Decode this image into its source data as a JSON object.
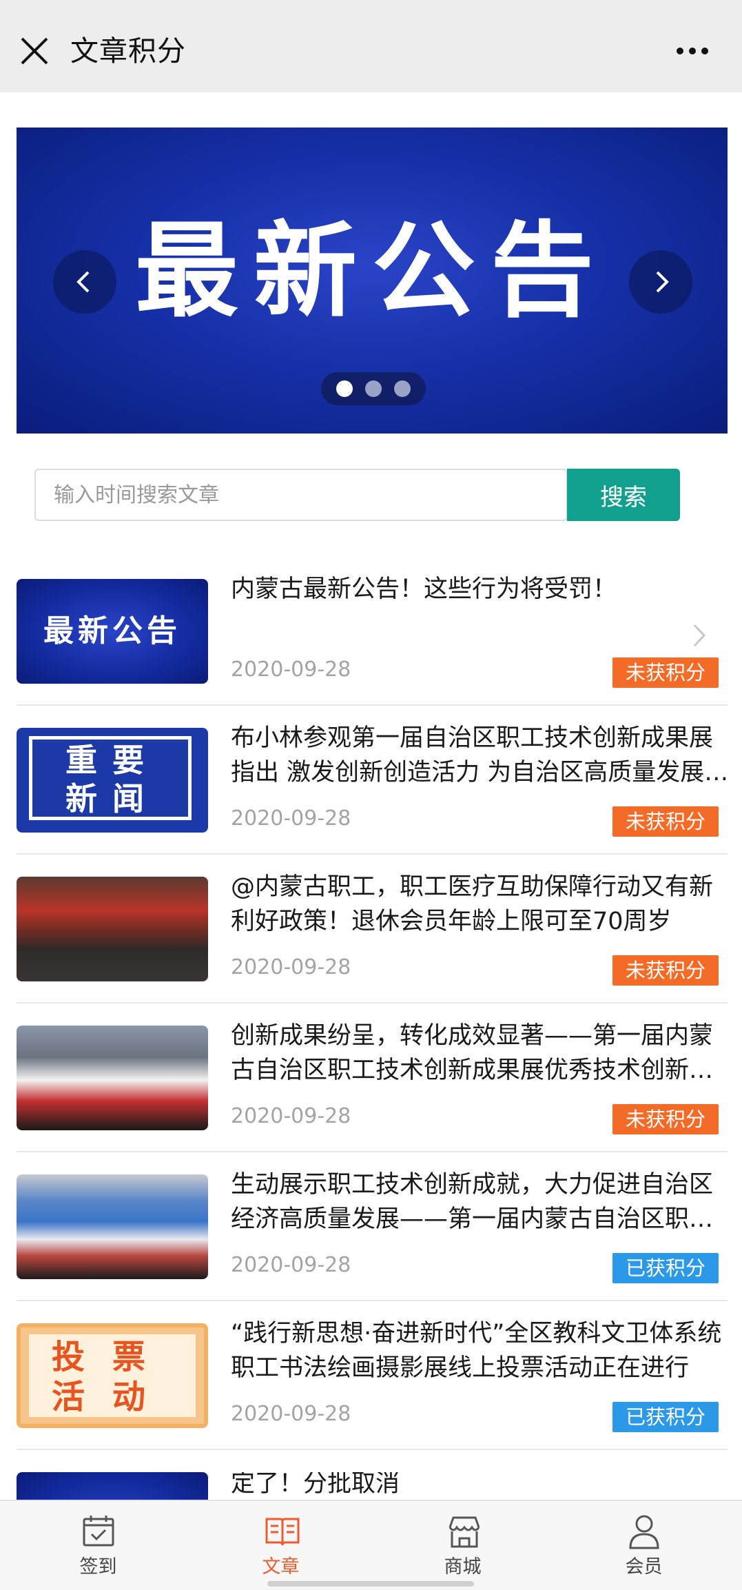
{
  "header": {
    "title": "文章积分"
  },
  "banner": {
    "title": "最新公告",
    "dots": [
      true,
      false,
      false
    ]
  },
  "search": {
    "placeholder": "输入时间搜索文章",
    "button_label": "搜索"
  },
  "articles": [
    {
      "thumb_text": "最新公告",
      "title": "内蒙古最新公告！这些行为将受罚！",
      "date": "2020-09-28",
      "status": "未获积分"
    },
    {
      "thumb_text": [
        "重要",
        "新闻"
      ],
      "title": "布小林参观第一届自治区职工技术创新成果展指出 激发创新创造活力 为自治区高质量发展贡献力量",
      "date": "2020-09-28",
      "status": "未获积分"
    },
    {
      "title": "@内蒙古职工，职工医疗互助保障行动又有新利好政策！退休会员年龄上限可至70周岁",
      "date": "2020-09-28",
      "status": "未获积分"
    },
    {
      "title": "创新成果纷呈，转化成效显著——第一届内蒙古自治区职工技术创新成果展优秀技术创新成果",
      "date": "2020-09-28",
      "status": "未获积分"
    },
    {
      "title": "生动展示职工技术创新成就，大力促进自治区经济高质量发展——第一届内蒙古自治区职工技术创新成果展",
      "date": "2020-09-28",
      "status": "已获积分"
    },
    {
      "thumb_text": [
        "投票",
        "活动"
      ],
      "title": "“践行新思想·奋进新时代”全区教科文卫体系统职工书法绘画摄影展线上投票活动正在进行",
      "date": "2020-09-28",
      "status": "已获积分"
    },
    {
      "title": "定了！分批取消"
    }
  ],
  "bottom_nav": [
    {
      "label": "签到",
      "icon": "calendar-check-icon",
      "active": false
    },
    {
      "label": "文章",
      "icon": "open-book-icon",
      "active": true
    },
    {
      "label": "商城",
      "icon": "store-icon",
      "active": false
    },
    {
      "label": "会员",
      "icon": "person-icon",
      "active": false
    }
  ],
  "colors": {
    "accent_green": "#12a08e",
    "badge_unearned": "#f46a27",
    "badge_earned": "#2b98e8",
    "nav_active": "#ef5a2b",
    "banner_blue": "#1630a8"
  }
}
